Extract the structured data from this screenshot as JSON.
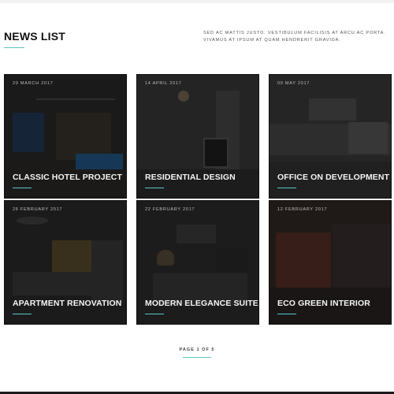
{
  "header": {
    "title": "NEWS LIST",
    "description": "SED AC MATTIS JUSTO. VESTIBULUM FACILISIS AT ARCU AC PORTA. VIVAMUS AT IPSUM AT QUAM HENDRERIT GRAVIDA."
  },
  "cards": [
    {
      "date": "20 MARCH 2017",
      "title": "CLASSIC HOTEL PROJECT"
    },
    {
      "date": "14 APRIL 2017",
      "title": "RESIDENTIAL DESIGN"
    },
    {
      "date": "09 MAY 2017",
      "title": "OFFICE ON DEVELOPMENT"
    },
    {
      "date": "26 FEBRUARY 2017",
      "title": "APARTMENT RENOVATION"
    },
    {
      "date": "22 FEBRUARY 2017",
      "title": "MODERN ELEGANCE SUITE"
    },
    {
      "date": "12 FEBRUARY 2017",
      "title": "ECO GREEN INTERIOR"
    }
  ],
  "pagination": {
    "label": "PAGE 1 OF 5"
  },
  "colors": {
    "accent": "#58c7c2",
    "card_overlay": "#1c1c1c",
    "heading": "#111111"
  }
}
